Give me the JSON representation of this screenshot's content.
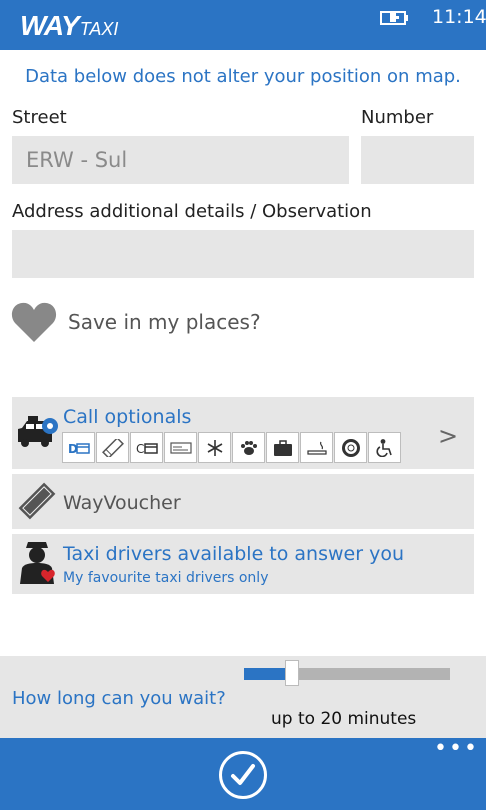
{
  "header": {
    "logo_main": "WAY",
    "logo_sub": "TAXI",
    "time": "11:14"
  },
  "notice": "Data below does not alter your position on map.",
  "form": {
    "street_label": "Street",
    "street_value": "ERW - Sul",
    "number_label": "Number",
    "number_value": "",
    "details_label": "Address additional details / Observation",
    "details_value": ""
  },
  "save_places": {
    "label": "Save in my places?"
  },
  "options": {
    "call_optionals_title": "Call optionals",
    "chevron": ">",
    "icons": [
      "debit-card-icon",
      "voucher-ticket-icon",
      "credit-card-icon",
      "cheque-icon",
      "air-conditioning-icon",
      "pet-paw-icon",
      "luggage-icon",
      "smoking-icon",
      "lifebuoy-icon",
      "wheelchair-icon"
    ],
    "icon_prefix_d": "D",
    "icon_prefix_c": "C"
  },
  "voucher": {
    "label": "WayVoucher"
  },
  "drivers": {
    "title": "Taxi drivers available to answer you",
    "subtitle": "My favourite taxi drivers only"
  },
  "wait": {
    "question": "How long can you wait?",
    "value_label": "up to 20 minutes",
    "slider_fraction": 0.2
  },
  "appbar": {
    "more": "•••"
  },
  "colors": {
    "accent": "#2b74c4",
    "field_bg": "#e6e6e6"
  }
}
